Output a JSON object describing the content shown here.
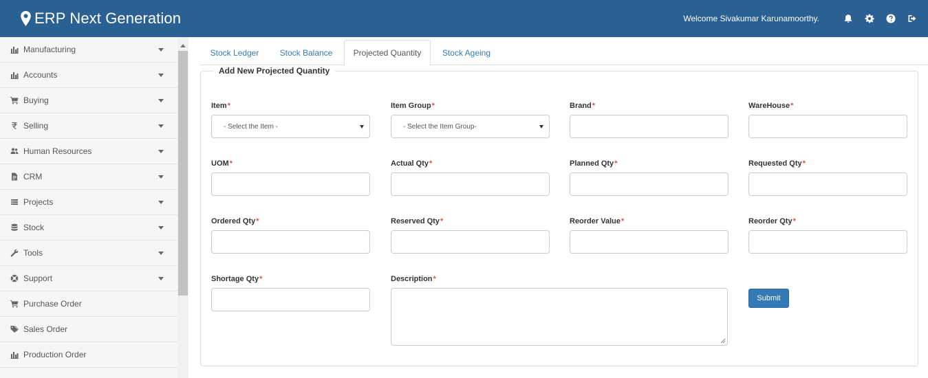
{
  "app": {
    "title": "ERP Next Generation",
    "welcome_label": "Welcome",
    "user_name": "Sivakumar  Karunamoorthy."
  },
  "header_icons": [
    "bell-icon",
    "gear-icon",
    "question-icon",
    "sign-out-icon"
  ],
  "sidebar": {
    "items": [
      {
        "label": "Manufacturing",
        "icon": "bar-chart-icon",
        "expandable": true
      },
      {
        "label": "Accounts",
        "icon": "bar-chart-icon",
        "expandable": true
      },
      {
        "label": "Buying",
        "icon": "cart-icon",
        "expandable": true
      },
      {
        "label": "Selling",
        "icon": "rupee-icon",
        "expandable": true
      },
      {
        "label": "Human Resources",
        "icon": "users-icon",
        "expandable": true
      },
      {
        "label": "CRM",
        "icon": "file-icon",
        "expandable": true
      },
      {
        "label": "Projects",
        "icon": "list-icon",
        "expandable": true
      },
      {
        "label": "Stock",
        "icon": "database-icon",
        "expandable": true
      },
      {
        "label": "Tools",
        "icon": "wrench-icon",
        "expandable": true
      },
      {
        "label": "Support",
        "icon": "life-ring-icon",
        "expandable": true
      },
      {
        "label": "Purchase Order",
        "icon": "cart-icon",
        "expandable": false
      },
      {
        "label": "Sales Order",
        "icon": "tags-icon",
        "expandable": false
      },
      {
        "label": "Production Order",
        "icon": "bar-chart-icon",
        "expandable": false
      }
    ]
  },
  "tabs": [
    {
      "label": "Stock Ledger",
      "active": false
    },
    {
      "label": "Stock Balance",
      "active": false
    },
    {
      "label": "Projected Quantity",
      "active": true
    },
    {
      "label": "Stock Ageing",
      "active": false
    }
  ],
  "form": {
    "legend": "Add New Projected Quantity",
    "required_marker": "*",
    "fields": {
      "item": {
        "label": "Item",
        "placeholder": "- Select the Item -"
      },
      "item_group": {
        "label": "Item Group",
        "placeholder": "- Select the Item Group-"
      },
      "brand": {
        "label": "Brand",
        "value": ""
      },
      "warehouse": {
        "label": "WareHouse",
        "value": ""
      },
      "uom": {
        "label": "UOM",
        "value": ""
      },
      "actual_qty": {
        "label": "Actual Qty",
        "value": ""
      },
      "planned_qty": {
        "label": "Planned Qty",
        "value": ""
      },
      "requested_qty": {
        "label": "Requested Qty",
        "value": ""
      },
      "ordered_qty": {
        "label": "Ordered Qty",
        "value": ""
      },
      "reserved_qty": {
        "label": "Reserved Qty",
        "value": ""
      },
      "reorder_value": {
        "label": "Reorder Value",
        "value": ""
      },
      "reorder_qty": {
        "label": "Reorder Qty",
        "value": ""
      },
      "shortage_qty": {
        "label": "Shortage Qty",
        "value": ""
      },
      "description": {
        "label": "Description",
        "value": ""
      }
    },
    "submit_label": "Submit"
  },
  "colors": {
    "header_bg": "#2a6092",
    "link": "#337ab7",
    "required": "#d9534f",
    "button": "#337ab7"
  }
}
